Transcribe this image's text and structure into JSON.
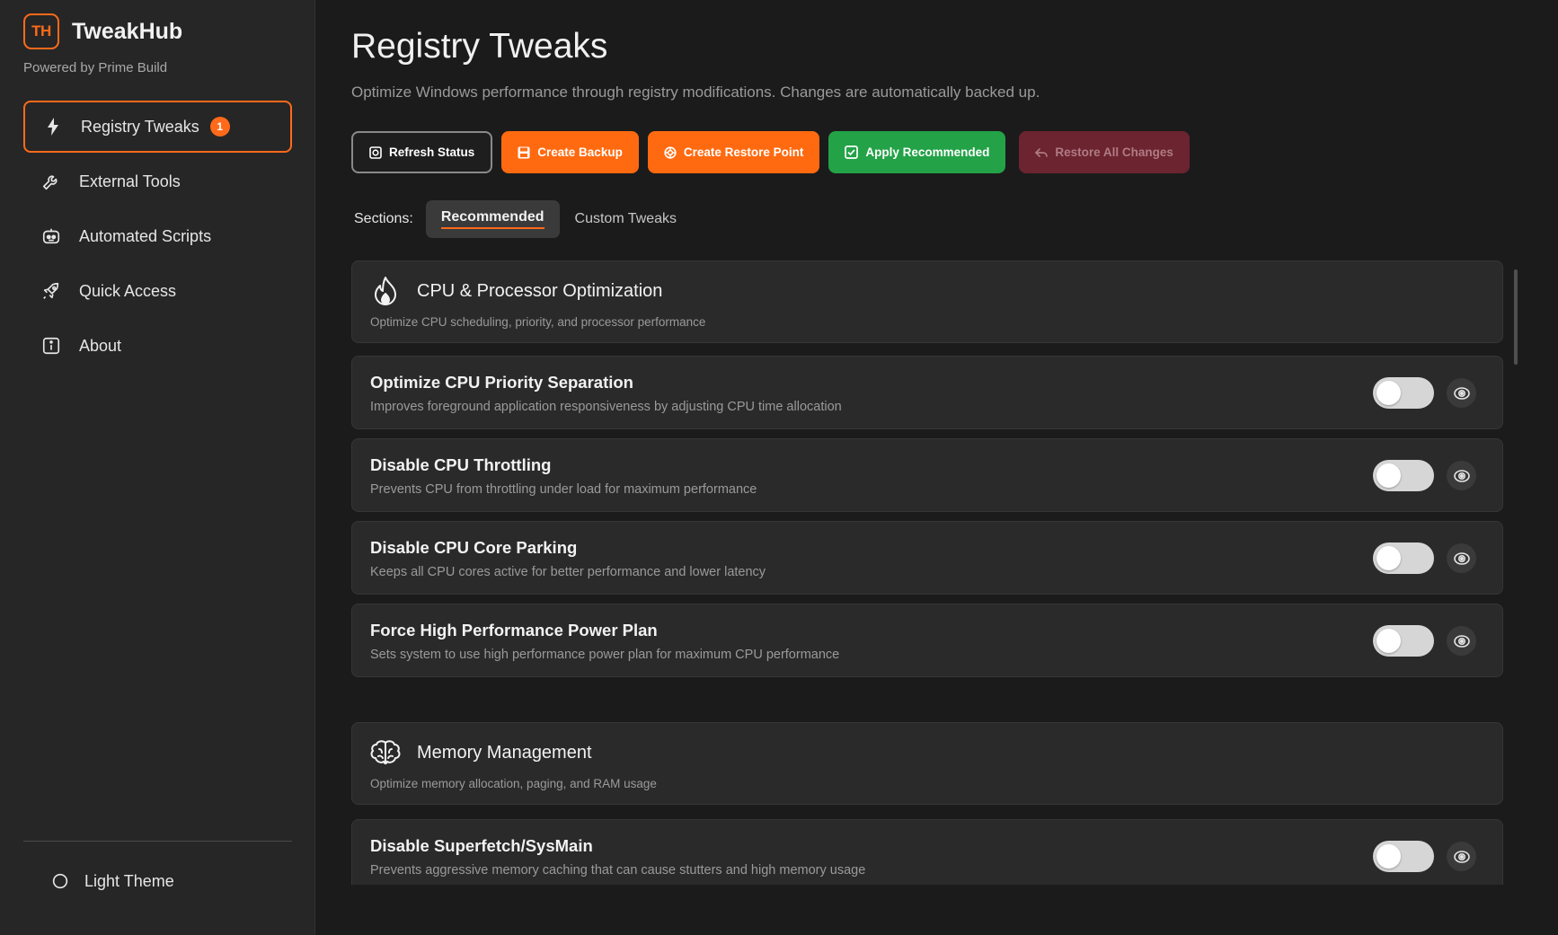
{
  "brand": {
    "logo_text": "TH",
    "name": "TweakHub",
    "subtitle": "Powered by Prime Build",
    "accent": "#ff6a1a"
  },
  "sidebar": {
    "items": [
      {
        "label": "Registry Tweaks",
        "icon": "bolt-icon",
        "badge": "1",
        "active": true
      },
      {
        "label": "External Tools",
        "icon": "wrench-icon"
      },
      {
        "label": "Automated Scripts",
        "icon": "robot-icon"
      },
      {
        "label": "Quick Access",
        "icon": "rocket-icon"
      },
      {
        "label": "About",
        "icon": "info-icon"
      }
    ],
    "theme_toggle": {
      "label": "Light Theme",
      "icon": "sun-icon"
    }
  },
  "page": {
    "title": "Registry Tweaks",
    "description": "Optimize Windows performance through registry modifications. Changes are automatically backed up."
  },
  "toolbar": {
    "refresh": "Refresh Status",
    "backup": "Create Backup",
    "restore_point": "Create Restore Point",
    "apply": "Apply Recommended",
    "restore_all": "Restore All Changes"
  },
  "sections_bar": {
    "label": "Sections:",
    "tabs": [
      {
        "label": "Recommended",
        "active": true
      },
      {
        "label": "Custom Tweaks",
        "active": false
      }
    ]
  },
  "groups": [
    {
      "title": "CPU & Processor Optimization",
      "description": "Optimize CPU scheduling, priority, and processor performance",
      "icon": "flame-icon",
      "tweaks": [
        {
          "title": "Optimize CPU Priority Separation",
          "description": "Improves foreground application responsiveness by adjusting CPU time allocation",
          "enabled": false
        },
        {
          "title": "Disable CPU Throttling",
          "description": "Prevents CPU from throttling under load for maximum performance",
          "enabled": false
        },
        {
          "title": "Disable CPU Core Parking",
          "description": "Keeps all CPU cores active for better performance and lower latency",
          "enabled": false
        },
        {
          "title": "Force High Performance Power Plan",
          "description": "Sets system to use high performance power plan for maximum CPU performance",
          "enabled": false
        }
      ]
    },
    {
      "title": "Memory Management",
      "description": "Optimize memory allocation, paging, and RAM usage",
      "icon": "brain-icon",
      "tweaks": [
        {
          "title": "Disable Superfetch/SysMain",
          "description": "Prevents aggressive memory caching that can cause stutters and high memory usage",
          "enabled": false
        }
      ]
    }
  ]
}
